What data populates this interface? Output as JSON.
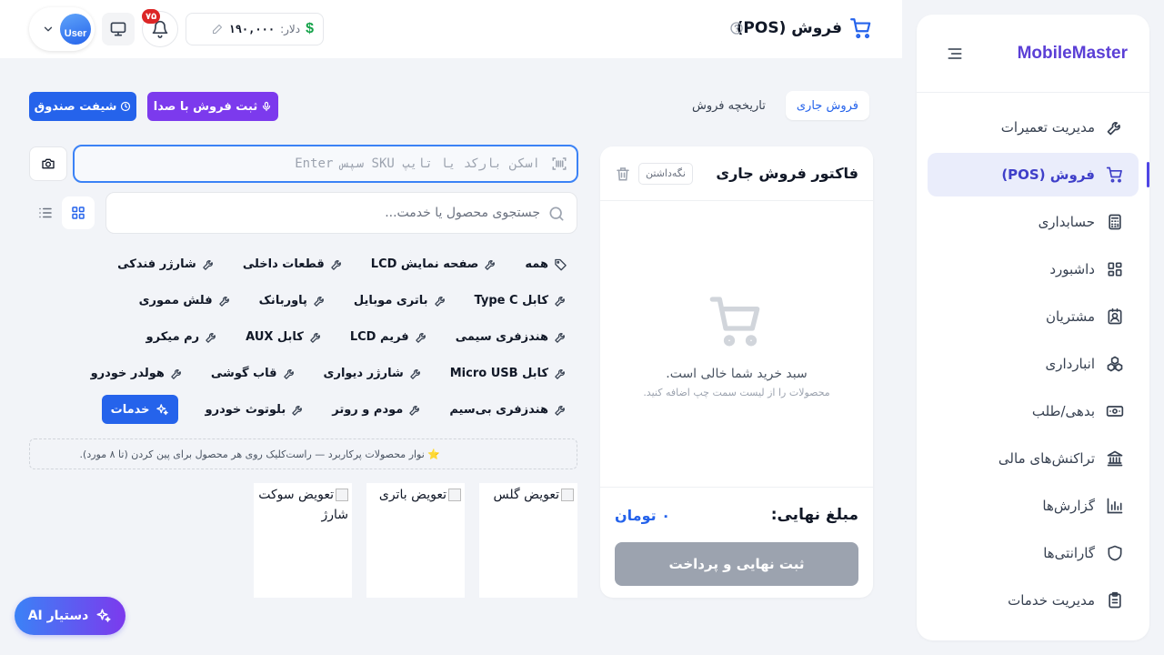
{
  "sidebar": {
    "logo": "MobileMaster",
    "items": [
      {
        "label": "مدیریت تعمیرات",
        "icon": "wrench-icon"
      },
      {
        "label": "فروش (POS)",
        "icon": "cart-icon",
        "active": true
      },
      {
        "label": "حسابداری",
        "icon": "calculator-icon"
      },
      {
        "label": "داشبورد",
        "icon": "dashboard-icon"
      },
      {
        "label": "مشتریان",
        "icon": "contact-icon"
      },
      {
        "label": "انبارداری",
        "icon": "boxes-icon"
      },
      {
        "label": "بدهی/طلب",
        "icon": "banknote-icon"
      },
      {
        "label": "تراکنش‌های مالی",
        "icon": "bank-icon"
      },
      {
        "label": "گزارش‌ها",
        "icon": "bar-chart-icon"
      },
      {
        "label": "گارانتی‌ها",
        "icon": "shield-icon"
      },
      {
        "label": "مدیریت خدمات",
        "icon": "clipboard-icon"
      }
    ]
  },
  "header": {
    "title": "فروش (POS)",
    "rate_label": "دلار:",
    "rate_value": "۱۹۰,۰۰۰",
    "rate_symbol": "$",
    "notification_count": "۷۵",
    "user_label": "User"
  },
  "tabs": [
    {
      "label": "فروش جاری",
      "active": true
    },
    {
      "label": "تاریخچه فروش",
      "active": false
    }
  ],
  "actions": {
    "voice_sale": "ثبت فروش با صدا",
    "cash_shift": "شیفت صندوق"
  },
  "invoice": {
    "title": "فاکتور فروش جاری",
    "hold_label": "نگه‌داشتن",
    "empty_title": "سبد خرید شما خالی است.",
    "empty_hint": "محصولات را از لیست سمت چپ اضافه کنید.",
    "total_label": "مبلغ نهایی:",
    "total_value": "۰ تومان",
    "pay_label": "ثبت نهایی و پرداخت"
  },
  "products": {
    "barcode_placeholder": "اسکن بارکد یا تایپ SKU سپس Enter",
    "search_placeholder": "جستجوی محصول یا خدمت...",
    "categories": [
      [
        "همه",
        "صفحه نمایش LCD",
        "قطعات داخلی",
        "شارژر فندکی"
      ],
      [
        "کابل Type C",
        "باتری موبایل",
        "پاوربانک",
        "فلش مموری"
      ],
      [
        "هندزفری سیمی",
        "فریم LCD",
        "کابل AUX",
        "رم میکرو"
      ],
      [
        "کابل Micro USB",
        "شارژر دیواری",
        "قاب گوشی",
        "هولدر خودرو"
      ],
      [
        "هندزفری بی‌سیم",
        "مودم و روتر",
        "بلوتوث خودرو",
        "خدمات"
      ]
    ],
    "pin_note": "⭐ نوار محصولات پرکاربرد — راست‌کلیک روی هر محصول برای پین کردن (تا ۸ مورد).",
    "cards": [
      {
        "title": "تعویض گلس"
      },
      {
        "title": "تعویض باتری"
      },
      {
        "title": "تعویض سوکت شارژ"
      }
    ]
  },
  "ai_assistant": "دستیار AI",
  "colors": {
    "primary": "#2563eb",
    "accent": "#7c3aed",
    "brand": "#5b3fd6",
    "badge": "#dc2626"
  }
}
